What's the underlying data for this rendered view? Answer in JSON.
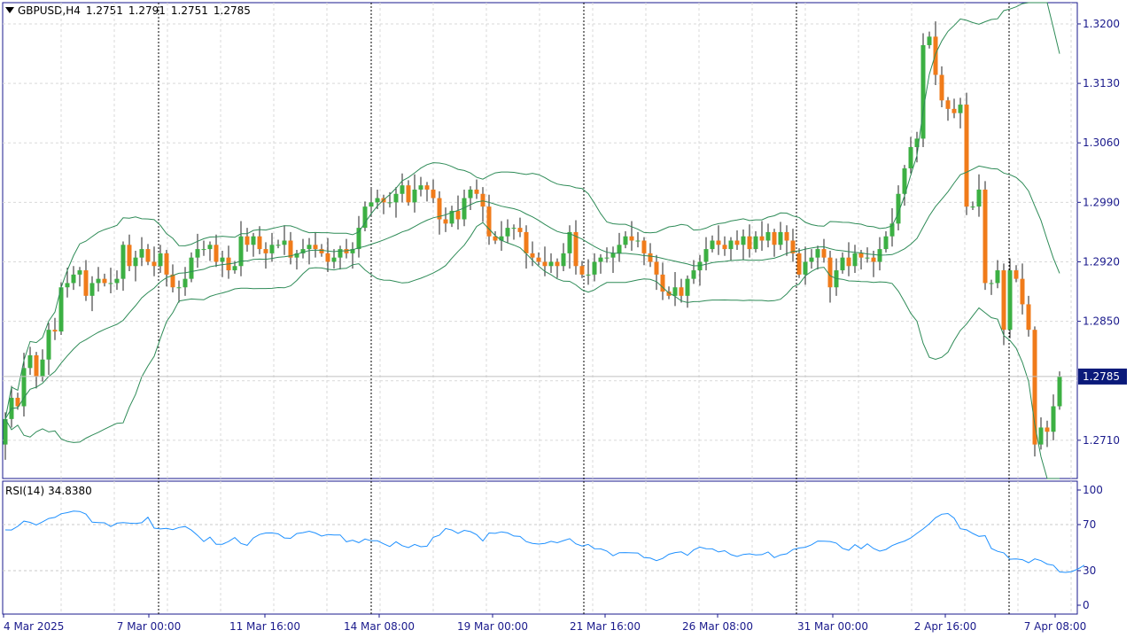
{
  "header": {
    "symbol": "GBPUSD,H4",
    "open": "1.2751",
    "high": "1.2791",
    "low": "1.2751",
    "close": "1.2785"
  },
  "rsi_panel": {
    "label": "RSI(14)",
    "value": "34.8380"
  },
  "current_price_label": "1.2785",
  "colors": {
    "bull": "#3cb043",
    "bear": "#f07b1a",
    "bands": "#2e8b57",
    "rsi": "#1e90ff",
    "axis": "#1a1a8c",
    "grid": "#d9d9d9"
  },
  "chart_data": [
    {
      "type": "candlestick",
      "title": "GBPUSD,H4",
      "ylim": [
        1.2665,
        1.3225
      ],
      "y_ticks": [
        "1.3200",
        "1.3130",
        "1.3060",
        "1.2990",
        "1.2920",
        "1.2850",
        "1.2710"
      ],
      "x_tick_labels": [
        "4 Mar 2025",
        "7 Mar 00:00",
        "11 Mar 16:00",
        "14 Mar 08:00",
        "19 Mar 00:00",
        "21 Mar 16:00",
        "26 Mar 08:00",
        "31 Mar 00:00",
        "2 Apr 16:00",
        "7 Apr 08:00"
      ],
      "close": [
        1.2735,
        1.276,
        1.275,
        1.2795,
        1.281,
        1.2785,
        1.2805,
        1.284,
        1.2838,
        1.289,
        1.2895,
        1.2905,
        1.291,
        1.288,
        1.2895,
        1.29,
        1.2895,
        1.2895,
        1.29,
        1.294,
        1.2915,
        1.2925,
        1.2935,
        1.292,
        1.2915,
        1.293,
        1.2905,
        1.289,
        1.289,
        1.29,
        1.2925,
        1.2935,
        1.2935,
        1.294,
        1.292,
        1.2925,
        1.291,
        1.2915,
        1.295,
        1.294,
        1.295,
        1.2935,
        1.293,
        1.294,
        1.294,
        1.2945,
        1.2925,
        1.293,
        1.2935,
        1.294,
        1.2935,
        1.293,
        1.292,
        1.2925,
        1.2935,
        1.293,
        1.2935,
        1.296,
        1.2985,
        1.299,
        1.2995,
        1.299,
        1.299,
        1.3,
        1.301,
        1.299,
        1.3005,
        1.301,
        1.3005,
        1.2995,
        1.297,
        1.2965,
        1.298,
        1.297,
        1.2995,
        1.3005,
        1.3,
        1.2985,
        1.295,
        1.2945,
        1.295,
        1.296,
        1.296,
        1.2955,
        1.293,
        1.2925,
        1.292,
        1.2915,
        1.292,
        1.2915,
        1.293,
        1.2955,
        1.2915,
        1.2905,
        1.2905,
        1.292,
        1.2925,
        1.2925,
        1.293,
        1.294,
        1.295,
        1.2945,
        1.2945,
        1.293,
        1.292,
        1.2905,
        1.2885,
        1.288,
        1.289,
        1.288,
        1.29,
        1.291,
        1.292,
        1.2935,
        1.2945,
        1.294,
        1.2935,
        1.2945,
        1.294,
        1.295,
        1.2935,
        1.295,
        1.2945,
        1.2955,
        1.294,
        1.2955,
        1.2945,
        1.293,
        1.2905,
        1.292,
        1.2925,
        1.2935,
        1.2925,
        1.289,
        1.291,
        1.2925,
        1.2915,
        1.293,
        1.2925,
        1.2925,
        1.292,
        1.2935,
        1.295,
        1.2965,
        1.3,
        1.303,
        1.3055,
        1.3065,
        1.3175,
        1.3185,
        1.314,
        1.311,
        1.31,
        1.3095,
        1.3105,
        1.2985,
        1.2985,
        1.3005,
        1.2895,
        1.2895,
        1.291,
        1.284,
        1.291,
        1.29,
        1.287,
        1.284,
        1.2705,
        1.2725,
        1.272,
        1.275,
        1.2785
      ],
      "indicators": [
        "Bollinger Bands (middle, upper, lower)"
      ]
    },
    {
      "type": "line",
      "title": "RSI(14) 34.8380",
      "ylim": [
        0,
        100
      ],
      "y_ticks": [
        100,
        70,
        30,
        0
      ],
      "levels": [
        70,
        30
      ],
      "values": [
        65.4,
        65.3,
        68.5,
        73.0,
        71.9,
        69.6,
        72.4,
        75.3,
        76.2,
        79.4,
        80.4,
        81.7,
        81.4,
        79.1,
        72.1,
        71.8,
        71.5,
        68.3,
        71.2,
        71.8,
        71.2,
        71.0,
        71.6,
        76.4,
        66.9,
        66.2,
        66.7,
        65.6,
        67.5,
        68.3,
        65.2,
        60.6,
        55.3,
        59.1,
        52.9,
        52.9,
        55.3,
        58.8,
        53.6,
        52.0,
        58.4,
        61.4,
        62.7,
        62.8,
        61.9,
        58.4,
        58.1,
        62.2,
        63.0,
        64.2,
        62.7,
        60.0,
        61.4,
        61.0,
        61.0,
        55.1,
        56.4,
        54.3,
        57.5,
        55.9,
        55.9,
        53.3,
        50.9,
        55.1,
        51.7,
        50.0,
        52.8,
        50.8,
        51.2,
        58.9,
        60.8,
        66.6,
        65.3,
        62.4,
        65.0,
        63.9,
        61.2,
        55.8,
        62.7,
        62.4,
        63.7,
        62.8,
        60.1,
        59.7,
        55.2,
        53.7,
        53.1,
        53.7,
        55.5,
        54.2,
        56.1,
        57.8,
        53.3,
        51.4,
        52.8,
        49.1,
        48.9,
        47.0,
        42.9,
        45.6,
        45.7,
        45.5,
        45.3,
        41.3,
        40.9,
        38.7,
        40.6,
        44.2,
        45.7,
        46.3,
        43.3,
        48.0,
        50.5,
        49.1,
        48.9,
        46.2,
        47.3,
        43.9,
        42.3,
        44.1,
        44.6,
        43.6,
        43.9,
        46.2,
        41.3,
        43.7,
        44.6,
        48.3,
        49.7,
        50.3,
        52.5,
        55.7,
        55.6,
        55.3,
        53.9,
        49.4,
        47.7,
        52.6,
        49.1,
        53.3,
        49.2,
        46.9,
        48.4,
        51.8,
        53.9,
        55.7,
        58.4,
        62.4,
        66.2,
        70.7,
        75.9,
        79.0,
        79.6,
        75.6,
        66.4,
        65.5,
        62.3,
        59.8,
        60.4,
        49.2,
        46.8,
        45.5,
        39.9,
        40.2,
        39.5,
        36.9,
        40.2,
        38.7,
        35.7,
        34.7,
        28.9,
        28.5,
        29.2,
        31.6,
        34.8
      ]
    }
  ]
}
